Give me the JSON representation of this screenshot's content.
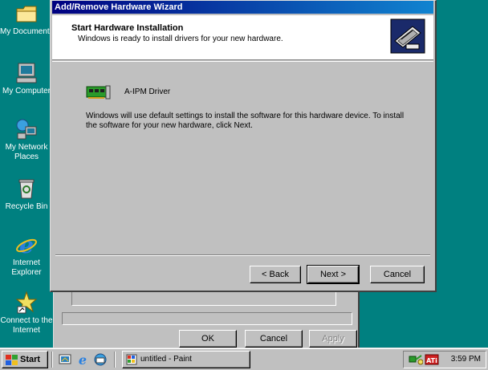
{
  "desktop": {
    "icons": [
      {
        "label": "My Documents",
        "icon": "folder-icon"
      },
      {
        "label": "My Computer",
        "icon": "computer-icon"
      },
      {
        "label": "My Network Places",
        "icon": "network-icon"
      },
      {
        "label": "Recycle Bin",
        "icon": "recycle-bin-icon"
      },
      {
        "label": "Internet Explorer",
        "icon": "ie-icon"
      },
      {
        "label": "Connect to the Internet",
        "icon": "connect-icon"
      }
    ],
    "background_color": "#008080"
  },
  "wizard": {
    "title": "Add/Remove Hardware Wizard",
    "header_title": "Start Hardware Installation",
    "header_subtitle": "Windows is ready to install drivers for your new hardware.",
    "device_name": "A-IPM Driver",
    "body_text": "Windows will use default settings to install the software for this hardware device. To install the software for your new hardware, click Next.",
    "buttons": {
      "back": "< Back",
      "next": "Next >",
      "cancel": "Cancel"
    }
  },
  "background_dialog": {
    "buttons": {
      "ok": "OK",
      "cancel": "Cancel",
      "apply": "Apply"
    }
  },
  "taskbar": {
    "start_label": "Start",
    "task_label": "untitled - Paint",
    "clock": "3:59 PM"
  },
  "colors": {
    "title_bar": "#000080",
    "dialog_face": "#c0c0c0"
  }
}
